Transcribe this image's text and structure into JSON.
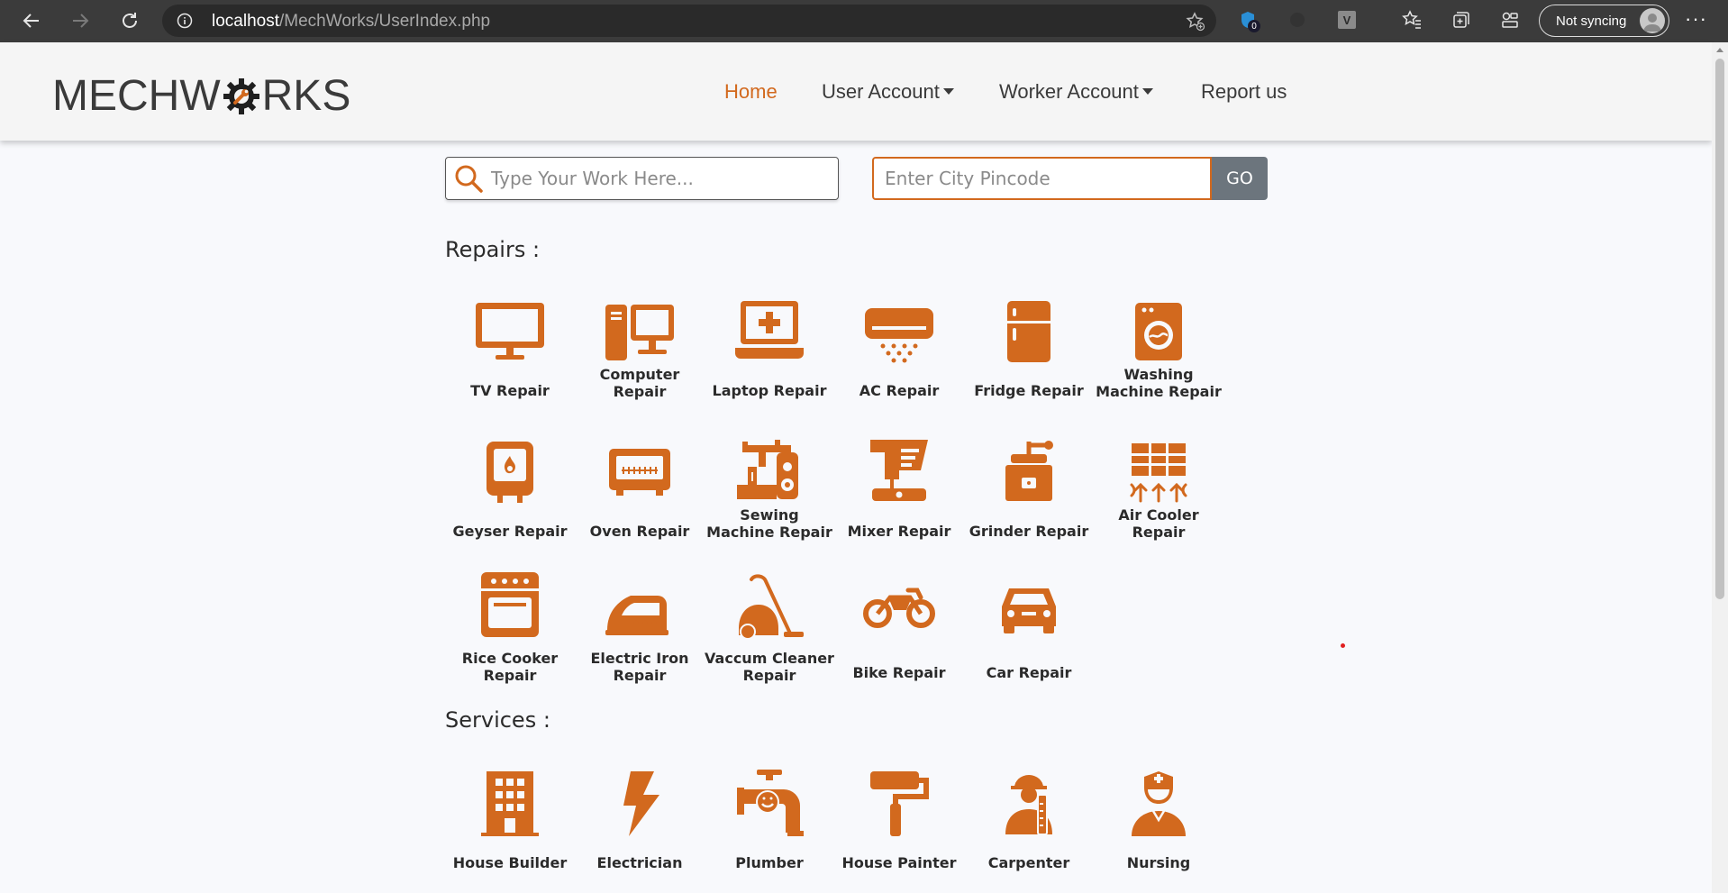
{
  "browser": {
    "url_host": "localhost",
    "url_path": "/MechWorks/UserIndex.php",
    "sync_label": "Not syncing",
    "ext_v_label": "V",
    "ext_badge": "0",
    "menu": "···"
  },
  "site": {
    "logo_left": "MECHW",
    "logo_right": "RKS",
    "nav": {
      "home": "Home",
      "user_account": "User Account",
      "worker_account": "Worker Account",
      "report": "Report us"
    },
    "accent_color": "#d2691e"
  },
  "search": {
    "work_placeholder": "Type Your Work Here...",
    "pincode_placeholder": "Enter City Pincode",
    "go_label": "GO"
  },
  "repairs": {
    "title": "Repairs :",
    "items": [
      {
        "label": "TV Repair",
        "icon": "tv-icon"
      },
      {
        "label": "Computer Repair",
        "icon": "computer-icon"
      },
      {
        "label": "Laptop Repair",
        "icon": "laptop-icon"
      },
      {
        "label": "AC Repair",
        "icon": "ac-icon"
      },
      {
        "label": "Fridge Repair",
        "icon": "fridge-icon"
      },
      {
        "label": "Washing Machine Repair",
        "icon": "washing-machine-icon"
      },
      {
        "label": "Geyser Repair",
        "icon": "geyser-icon"
      },
      {
        "label": "Oven Repair",
        "icon": "oven-icon"
      },
      {
        "label": "Sewing Machine Repair",
        "icon": "sewing-machine-icon"
      },
      {
        "label": "Mixer Repair",
        "icon": "mixer-icon"
      },
      {
        "label": "Grinder Repair",
        "icon": "grinder-icon"
      },
      {
        "label": "Air Cooler Repair",
        "icon": "air-cooler-icon"
      },
      {
        "label": "Rice Cooker Repair",
        "icon": "rice-cooker-icon"
      },
      {
        "label": "Electric Iron Repair",
        "icon": "iron-icon"
      },
      {
        "label": "Vaccum Cleaner Repair",
        "icon": "vacuum-cleaner-icon"
      },
      {
        "label": "Bike Repair",
        "icon": "bike-icon"
      },
      {
        "label": "Car Repair",
        "icon": "car-icon"
      }
    ]
  },
  "services": {
    "title": "Services :",
    "items": [
      {
        "label": "House Builder",
        "icon": "building-icon"
      },
      {
        "label": "Electrician",
        "icon": "lightning-icon"
      },
      {
        "label": "Plumber",
        "icon": "plumber-icon"
      },
      {
        "label": "House Painter",
        "icon": "paint-roller-icon"
      },
      {
        "label": "Carpenter",
        "icon": "carpenter-icon"
      },
      {
        "label": "Nursing",
        "icon": "nurse-icon"
      }
    ]
  }
}
